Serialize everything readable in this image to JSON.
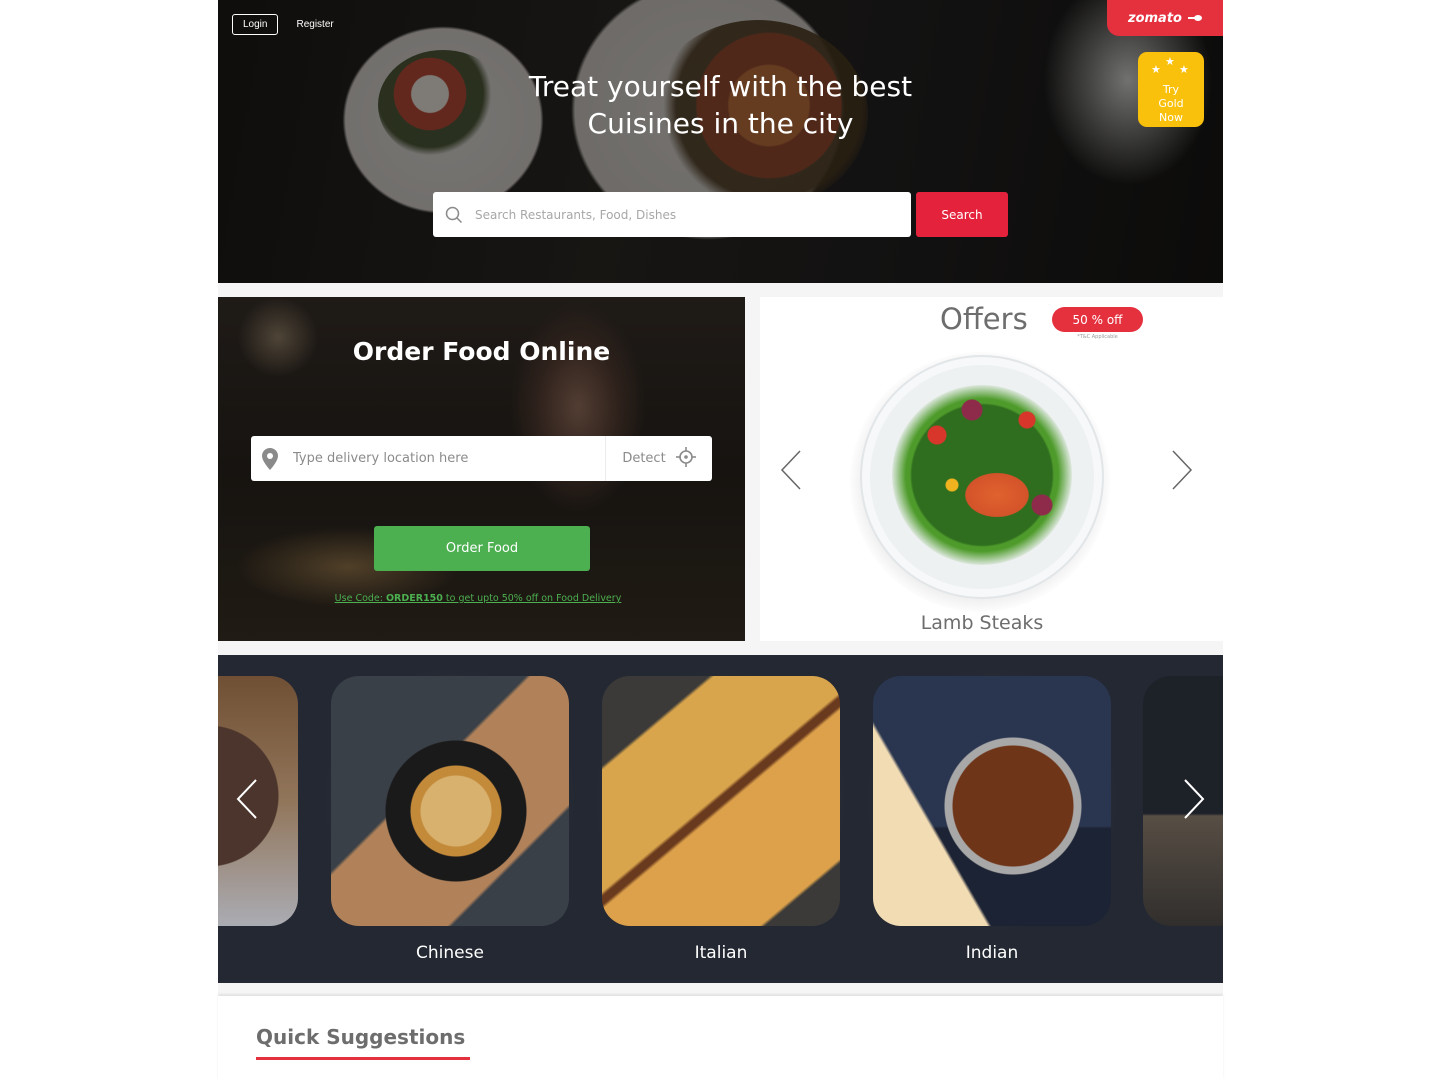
{
  "header": {
    "login_label": "Login",
    "register_label": "Register",
    "brand": "zomato",
    "gold_badge": {
      "line1": "Try",
      "line2": "Gold",
      "line3": "Now"
    },
    "hero_title_line1": "Treat yourself with the best",
    "hero_title_line2": "Cuisines in the city",
    "search": {
      "placeholder": "Search Restaurants, Food, Dishes",
      "value": "",
      "button_label": "Search"
    }
  },
  "order_panel": {
    "title": "Order Food Online",
    "location_placeholder": "Type delivery location here",
    "location_value": "",
    "detect_label": "Detect",
    "order_button_label": "Order Food",
    "promo_prefix": "Use Code: ",
    "promo_code": "ORDER150",
    "promo_suffix": " to get upto  50% off on Food Delivery"
  },
  "offers": {
    "title": "Offers",
    "badge": "50 % off",
    "terms": "*T&C Applicable",
    "current_dish": "Lamb Steaks"
  },
  "cuisines": {
    "items": [
      {
        "label": "Chinese"
      },
      {
        "label": "Italian"
      },
      {
        "label": "Indian"
      }
    ]
  },
  "quick_suggestions": {
    "title": "Quick Suggestions"
  },
  "colors": {
    "brand_red": "#e5303e",
    "search_red": "#e5223b",
    "gold_yellow": "#f9c00c",
    "order_green": "#4caf50",
    "cuisine_bg": "#232833"
  }
}
